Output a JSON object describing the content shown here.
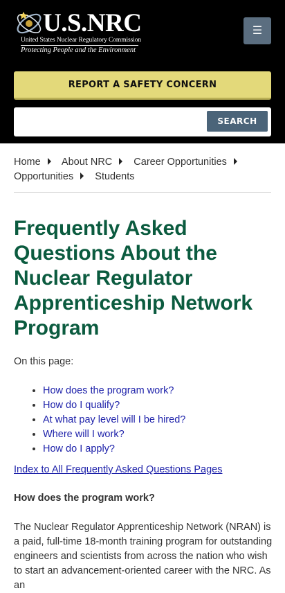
{
  "header": {
    "logo_title": "U.S.NRC",
    "logo_subtitle": "United States Nuclear Regulatory Commission",
    "logo_tagline": "Protecting People and the Environment",
    "menu_icon": "bars-icon",
    "safety_button": "REPORT A SAFETY CONCERN",
    "search_placeholder": "",
    "search_button": "SEARCH",
    "colors": {
      "header_bg": "#000000",
      "safety": "#e3d97a",
      "search_btn": "#4b6479",
      "menu_btn": "#5b6e80"
    }
  },
  "breadcrumb": [
    {
      "label": "Home"
    },
    {
      "label": "About NRC"
    },
    {
      "label": "Career Opportunities"
    },
    {
      "label": "Opportunities"
    },
    {
      "label": "Students"
    }
  ],
  "page": {
    "title": "Frequently Asked Questions About the Nuclear Regulator Apprenticeship Network Program",
    "title_color": "#0b5b3f",
    "on_this_page": "On this page:",
    "toc": [
      "How does the program work?",
      "How do I qualify?",
      "At what pay level will I be hired?",
      "Where will I work?",
      "How do I apply?"
    ],
    "index_link": "Index to All Frequently Asked Questions Pages",
    "section_heading": "How does the program work?",
    "section_body": "The Nuclear Regulator Apprenticeship Network (NRAN) is a paid, full-time 18-month training program for outstanding engineers and scientists from across the nation who wish to start an advancement-oriented career with the NRC. As an"
  }
}
